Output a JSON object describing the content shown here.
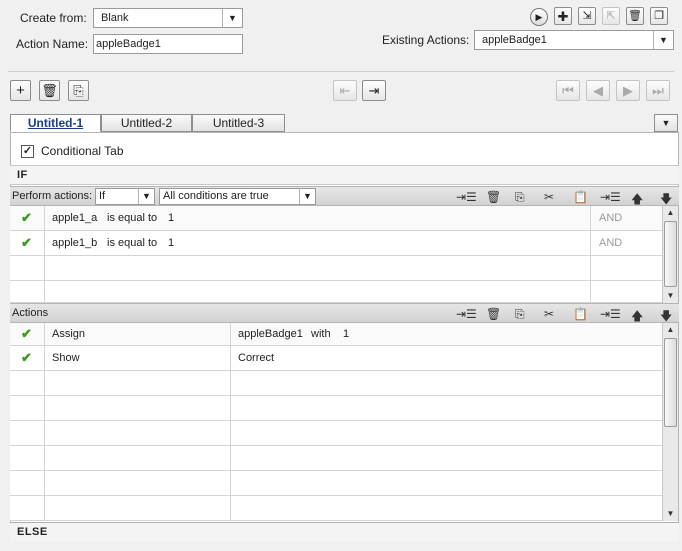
{
  "form": {
    "create_from_label": "Create from:",
    "create_from_value": "Blank",
    "action_name_label": "Action Name:",
    "action_name_value": "appleBadge1",
    "existing_actions_label": "Existing Actions:",
    "existing_actions_value": "appleBadge1"
  },
  "tabs": [
    "Untitled-1",
    "Untitled-2",
    "Untitled-3"
  ],
  "conditional_tab_label": "Conditional Tab",
  "conditional_tab_checked": true,
  "if_label": "IF",
  "else_label": "ELSE",
  "conditions_bar": {
    "perform_actions_label": "Perform actions:",
    "perform_value": "If",
    "condition_mode": "All conditions are true"
  },
  "conditions": [
    {
      "variable": "apple1_a",
      "operator": "is equal to",
      "value": "1",
      "join": "AND"
    },
    {
      "variable": "apple1_b",
      "operator": "is equal to",
      "value": "1",
      "join": "AND"
    }
  ],
  "actions_bar_label": "Actions",
  "actions": [
    {
      "action": "Assign",
      "target": "appleBadge1",
      "connector": "with",
      "value": "1"
    },
    {
      "action": "Show",
      "target": "Correct",
      "connector": "",
      "value": ""
    }
  ],
  "check_glyph": "✔",
  "colors": {
    "active_tab": "#1a3c8c",
    "check": "#3a9a1a"
  }
}
